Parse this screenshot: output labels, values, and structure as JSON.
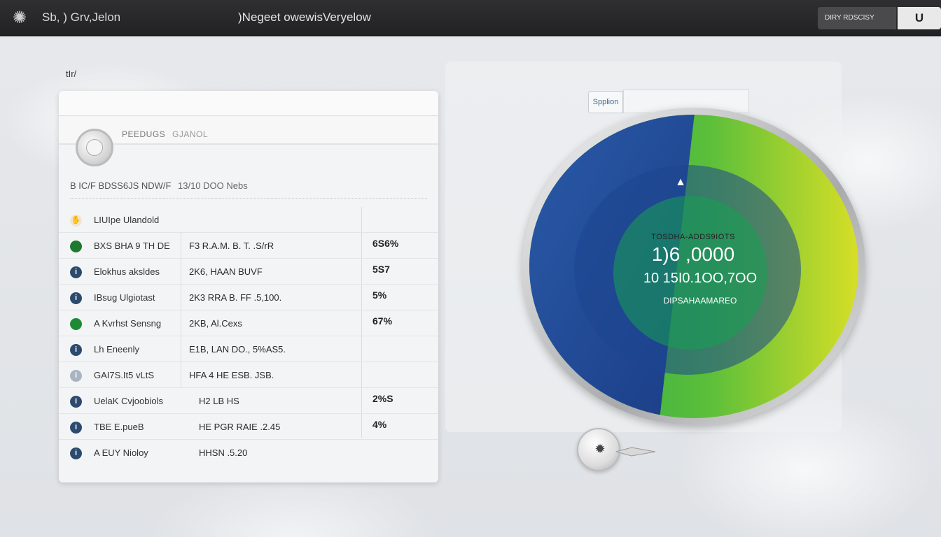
{
  "topbar": {
    "logo_icon": "sunburst-icon",
    "app_name": "Sb, ) Grv,Jelon",
    "center_title": ")Negeet owewisVeryelow",
    "user_label": "DIRY RDSCISY",
    "user_button": "U"
  },
  "left": {
    "section_label": "tIr/",
    "header_title": "PEEDUGS",
    "header_sub": "GJANOL",
    "summary": "B IC/F BDSS6JS NDW/F",
    "summary2": "13/10 DOO Nebs",
    "rows": [
      {
        "icon": "hand-icon",
        "name": "LIUIpe Ulandold",
        "detail": "",
        "pct": ""
      },
      {
        "icon": "dot-icon",
        "name": "BXS BHA 9 TH DE",
        "detail": "F3 R.A.M. B. T. .S/rR",
        "pct": "6S6%"
      },
      {
        "icon": "info-icon",
        "name": "Elokhus aksldes",
        "detail": "2K6, HAAN BUVF",
        "pct": "5S7"
      },
      {
        "icon": "info-icon",
        "name": "IBsug Ulgiotast",
        "detail": "2K3 RRA B. FF .5,100.",
        "pct": "5%"
      },
      {
        "icon": "dot-icon",
        "name": "A Kvrhst Sensng",
        "detail": "2KB, Al.Cexs",
        "pct": "67%"
      },
      {
        "icon": "info-icon",
        "name": "Lh Eneenly",
        "detail": "E1B, LAN DO., 5%AS5.",
        "pct": ""
      },
      {
        "icon": "info-icon",
        "name": "GAI7S.It5 vLtS",
        "detail": "HFA 4 HE ESB. JSB.",
        "pct": ""
      },
      {
        "icon": "info-icon",
        "name": "UelaK Cvjoobiols",
        "detail": "H2 LB HS",
        "pct": "2%S"
      },
      {
        "icon": "info-icon",
        "name": "TBE E.pueB",
        "detail": "HE PGR RAIE .2.45",
        "pct": "4%"
      },
      {
        "icon": "info-icon",
        "name": "A EUY Nioloy",
        "detail": "HHSN .5.20",
        "pct": ""
      }
    ]
  },
  "right": {
    "filter_label": "Spplion",
    "gauge_small": "TOSDHA-ADDS9IOTS",
    "gauge_big": "1)6 ,0000",
    "gauge_mid": "10 15I0.1OO,7OO",
    "gauge_label": "DIPSAHAAMAREO",
    "colors": {
      "blue": "#1f4c9a",
      "green": "#1fa64a",
      "lime": "#c7d92a"
    }
  }
}
